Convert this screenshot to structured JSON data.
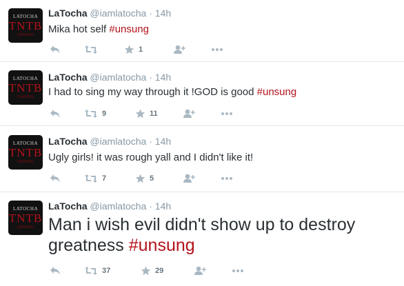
{
  "tweets": [
    {
      "name": "LaTocha",
      "handle": "@iamlatocha",
      "time": "· 14h",
      "text": "Mika hot self ",
      "hashtag": "#unsung",
      "retweets": "",
      "favorites": "1"
    },
    {
      "name": "LaTocha",
      "handle": "@iamlatocha",
      "time": "· 14h",
      "text": "I had to sing my way through it !GOD is good ",
      "hashtag": "#unsung",
      "retweets": "9",
      "favorites": "11"
    },
    {
      "name": "LaTocha",
      "handle": "@iamlatocha",
      "time": "· 14h",
      "text": "Ugly girls! it was rough yall and I didn't like it!",
      "hashtag": "",
      "retweets": "7",
      "favorites": "5"
    },
    {
      "name": "LaTocha",
      "handle": "@iamlatocha",
      "time": "· 14h",
      "text_line1": "Man i wish evil didn't show up to destroy",
      "text_line2": "greatness ",
      "hashtag": "#unsung",
      "retweets": "37",
      "favorites": "29"
    }
  ],
  "avatar": {
    "top": "LATOCHA",
    "main": "TNTB",
    "sub": "SINGING"
  },
  "icons": [
    "reply-icon",
    "retweet-icon",
    "favorite-icon",
    "follow-icon",
    "more-icon"
  ],
  "colors": {
    "hashtag": "#b3121b",
    "icon": "#aab8c2",
    "text": "#292f33",
    "meta": "#8899a6"
  }
}
